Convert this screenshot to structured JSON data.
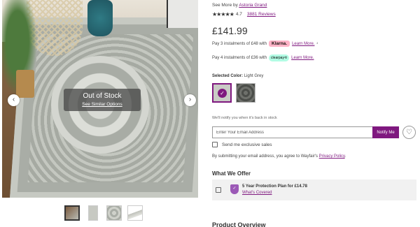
{
  "product": {
    "title_fragment": "",
    "seller_prefix": "See More by",
    "seller_name": "Astoria Grand",
    "rating_value": "4.7",
    "stars": "★★★★★",
    "reviews": "3881 Reviews",
    "price": "£141.99"
  },
  "gallery": {
    "out_of_stock_title": "Out of Stock",
    "similar_link": "See Similar Options",
    "prev_arrow": "‹",
    "next_arrow": "›",
    "thumbnail_count": 4,
    "selected_thumbnail": 1
  },
  "installments": {
    "klarna_text": "Pay 3 instalments of £48 with",
    "klarna_badge": "Klarna.",
    "klarna_learn": "Learn More.",
    "klarna_sup": "²",
    "clearpay_text": "Pay 4 instalments of £36 with",
    "clearpay_badge": "clearpay⟲",
    "clearpay_learn": "Learn More."
  },
  "color": {
    "label": "Selected Color:",
    "value": "Light Grey",
    "selected_check": "✓"
  },
  "notify": {
    "message": "We'll notify you when it's back in stock",
    "email_placeholder": "Enter Your Email Address",
    "button": "Notify Me",
    "heart": "♡",
    "exclusive_sales": "Send me exclusive sales",
    "agree_text": "By submitting your email address, you agree to Wayfair's",
    "privacy_link": "Privacy Policy",
    "agree_end": "."
  },
  "offer": {
    "heading": "What We Offer",
    "plan": "5 Year Protection Plan for £14.78",
    "covered_link": "What's Covered",
    "shield": "✓"
  },
  "overview_heading": "Product Overview",
  "colors": {
    "accent": "#7f187f",
    "klarna_pink": "#ffb3c7",
    "clearpay_mint": "#b2fce4"
  }
}
